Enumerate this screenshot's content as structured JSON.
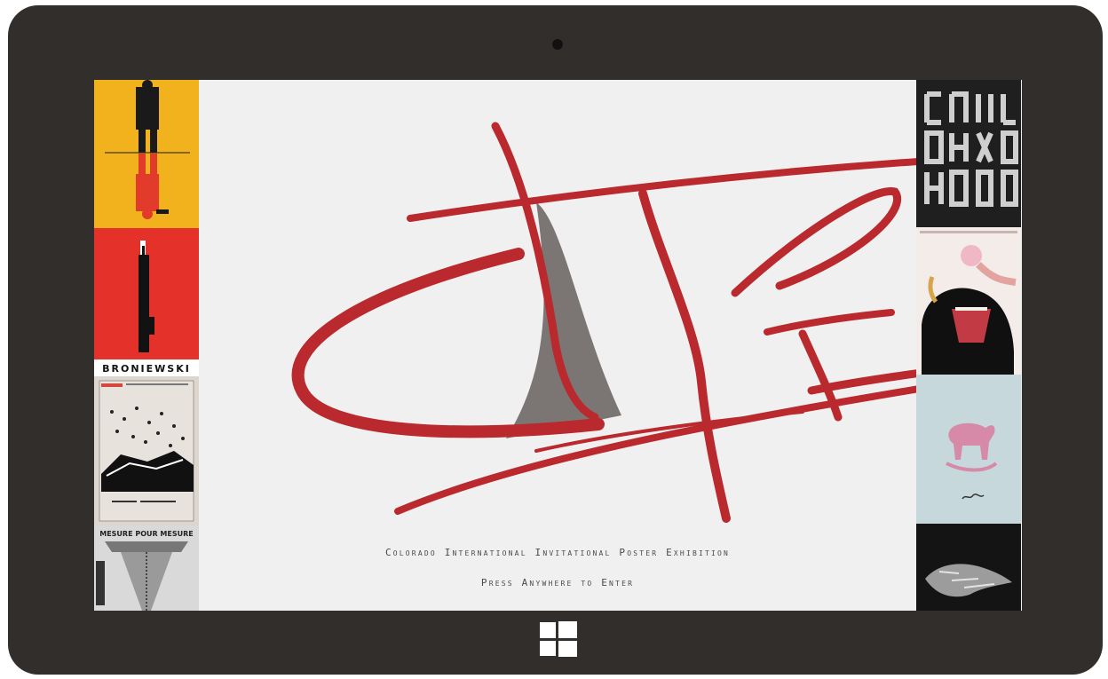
{
  "app": {
    "exhibition_title": "Colorado International Invitational Poster Exhibition",
    "enter_prompt": "Press Anywhere to Enter",
    "logo_text": "CIIPE"
  },
  "left_posters": [
    {
      "name": "poster-yellow-figure",
      "bg": "#f2b21d"
    },
    {
      "name": "poster-broniewski",
      "bg": "#e4322b",
      "caption": "BRONIEWSKI"
    },
    {
      "name": "poster-musical-notes",
      "bg": "#ddd6cf"
    },
    {
      "name": "poster-zipper",
      "bg": "#d9d9d9",
      "caption": "MESURE POUR MESURE"
    }
  ],
  "right_posters": [
    {
      "name": "poster-black-typography",
      "bg": "#1f1f1f"
    },
    {
      "name": "poster-gorilla",
      "bg": "#f4ece8"
    },
    {
      "name": "poster-pink-horse",
      "bg": "#c7d8dd"
    },
    {
      "name": "poster-hand-sculpture",
      "bg": "#141414"
    }
  ],
  "colors": {
    "bezel": "#322e2c",
    "logo_red": "#b9292e",
    "logo_gray": "#7b7674",
    "text": "#4a4a4a"
  },
  "icons": {
    "camera": "camera-icon",
    "windows": "windows-logo-icon"
  }
}
